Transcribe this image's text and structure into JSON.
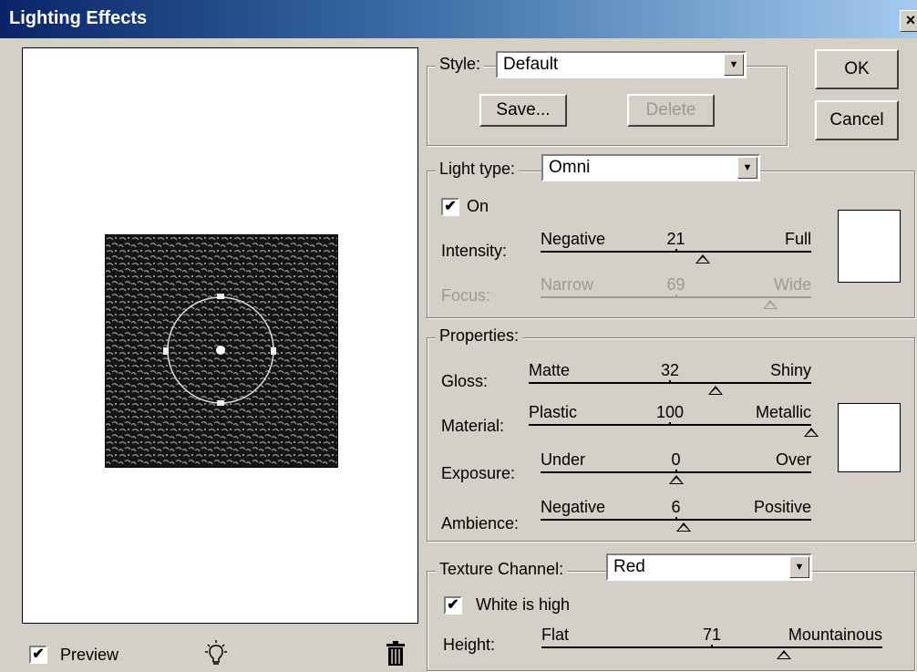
{
  "window": {
    "title": "Lighting Effects",
    "close_glyph": "×"
  },
  "preview": {
    "label": "Preview",
    "checked": true,
    "bulb_icon": "light-bulb-icon",
    "trash_icon": "trash-icon"
  },
  "style": {
    "label": "Style:",
    "selected": "Default",
    "save": "Save...",
    "delete": "Delete"
  },
  "buttons": {
    "ok": "OK",
    "cancel": "Cancel"
  },
  "light": {
    "label": "Light type:",
    "selected": "Omni",
    "on_label": "On",
    "on_checked": true,
    "intensity": {
      "label": "Intensity:",
      "min": "Negative",
      "value": "21",
      "max": "Full",
      "fraction": 0.6
    },
    "focus": {
      "label": "Focus:",
      "min": "Narrow",
      "value": "69",
      "max": "Wide",
      "fraction": 0.85
    }
  },
  "properties": {
    "legend": "Properties:",
    "gloss": {
      "label": "Gloss:",
      "min": "Matte",
      "value": "32",
      "max": "Shiny",
      "fraction": 0.66
    },
    "material": {
      "label": "Material:",
      "min": "Plastic",
      "value": "100",
      "max": "Metallic",
      "fraction": 1.0
    },
    "exposure": {
      "label": "Exposure:",
      "min": "Under",
      "value": "0",
      "max": "Over",
      "fraction": 0.5
    },
    "ambience": {
      "label": "Ambience:",
      "min": "Negative",
      "value": "6",
      "max": "Positive",
      "fraction": 0.53
    }
  },
  "texture": {
    "label": "Texture Channel:",
    "selected": "Red",
    "white_high_label": "White is high",
    "white_high_checked": true,
    "height": {
      "label": "Height:",
      "min": "Flat",
      "value": "71",
      "max": "Mountainous",
      "fraction": 0.71
    }
  },
  "colors": {
    "title_start": "#0a246a",
    "title_end": "#a6caf0",
    "face": "#d4d0c8"
  }
}
